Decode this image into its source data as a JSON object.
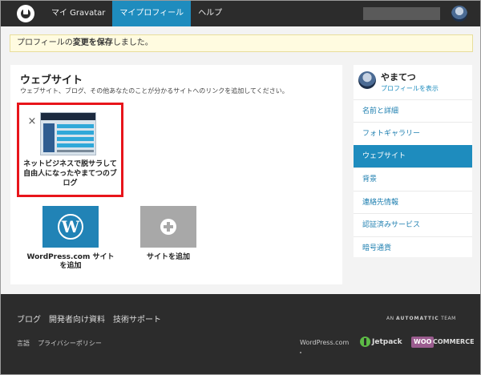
{
  "topbar": {
    "nav": [
      "マイ Gravatar",
      "マイプロフィール",
      "ヘルプ"
    ],
    "active_index": 1
  },
  "notice": {
    "prefix": "プロフィールの",
    "bold": "変更を保存",
    "suffix": "しました。"
  },
  "websites": {
    "title": "ウェブサイト",
    "description": "ウェブサイト、ブログ、その他あなたのことが分かるサイトへのリンクを追加してください。",
    "site_name": "ネットビジネスで脱サラして自由人になったやまてつのブログ",
    "remove_symbol": "×",
    "add_wp_label": "WordPress.com サイトを追加",
    "add_site_label": "サイトを追加"
  },
  "sidebar": {
    "name": "やまてつ",
    "view_profile": "プロフィールを表示",
    "items": [
      "名前と詳細",
      "フォトギャラリー",
      "ウェブサイト",
      "背景",
      "連絡先情報",
      "認証済みサービス",
      "暗号通貨"
    ],
    "active_index": 2
  },
  "footer": {
    "links": [
      "ブログ",
      "開発者向け資料",
      "技術サポート"
    ],
    "sub_links": [
      "言語",
      "プライバシーポリシー"
    ],
    "an": "AN",
    "automattic": "AUTOMATTIC",
    "team": "TEAM",
    "wordpress": "WordPress.com",
    "jetpack": "Jetpack",
    "woo": "WOO",
    "commerce": "COMMERCE"
  },
  "colors": {
    "accent": "#1e8cbe",
    "highlight_border": "#e8151b",
    "topbar": "#2c2c2c"
  }
}
